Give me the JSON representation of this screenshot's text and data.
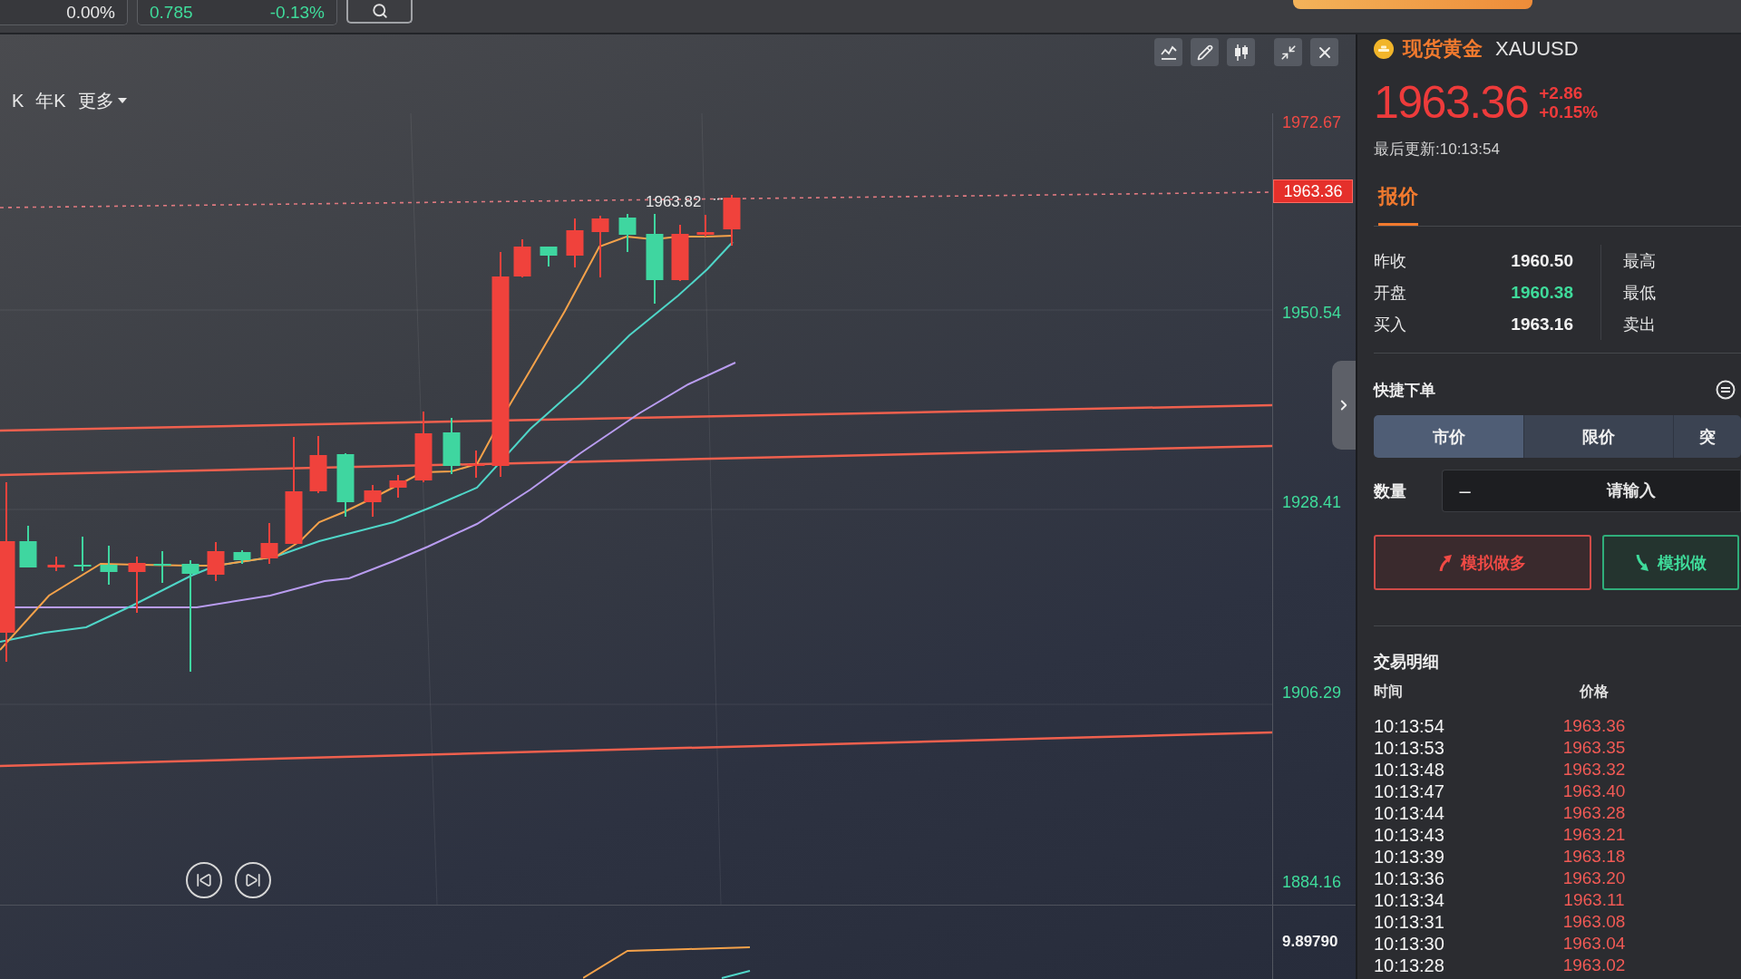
{
  "top_bar": {
    "quote_cards": [
      {
        "values": [
          {
            "text": "0.00%",
            "color": "#e8e8e8"
          }
        ]
      },
      {
        "values": [
          {
            "text": "0.785",
            "color": "#3fdc9b"
          },
          {
            "text": "-0.13%",
            "color": "#3fdc9b"
          }
        ]
      }
    ]
  },
  "chart": {
    "periods": [
      {
        "label": "K",
        "selected": false
      },
      {
        "label": "年K",
        "selected": false
      }
    ],
    "more_menu": {
      "label": "更多"
    },
    "y_axis": [
      {
        "label": "1972.67",
        "color": "#f04a45"
      },
      {
        "label": "1950.54",
        "color": "#3fdc9b"
      },
      {
        "label": "1928.41",
        "color": "#3fdc9b"
      },
      {
        "label": "1906.29",
        "color": "#3fdc9b"
      },
      {
        "label": "1884.16",
        "color": "#3fdc9b"
      }
    ],
    "price_tag": "1963.36",
    "high_marker": "1963.82",
    "indicator_axis": "9.89790"
  },
  "instrument": {
    "name": "现货黄金",
    "symbol": "XAUUSD",
    "price": "1963.36",
    "change": "+2.86",
    "change_percent": "+0.15%",
    "color": "#ee3b3b",
    "updated": "最后更新:10:13:54"
  },
  "quote_tabs": [
    {
      "label": "报价",
      "selected": true
    }
  ],
  "quote_rows": [
    {
      "label": "昨收",
      "value": "1960.50",
      "color": "#f2f2f2",
      "side_label": "最高"
    },
    {
      "label": "开盘",
      "value": "1960.38",
      "color": "#3fdc9b",
      "side_label": "最低"
    },
    {
      "label": "买入",
      "value": "1963.16",
      "color": "#f2f2f2",
      "side_label": "卖出"
    }
  ],
  "quick_order": {
    "title": "快捷下单",
    "order_types": [
      {
        "label": "市价",
        "selected": true
      },
      {
        "label": "限价",
        "selected": false
      },
      {
        "label": "突",
        "selected": false
      }
    ],
    "quantity": {
      "label": "数量",
      "decrement": "–",
      "placeholder": "请输入"
    },
    "actions": [
      {
        "label": "模拟做多",
        "kind": "long"
      },
      {
        "label": "模拟做",
        "kind": "short"
      }
    ]
  },
  "trades": {
    "title": "交易明细",
    "columns": [
      "时间",
      "价格"
    ],
    "rows": [
      {
        "time": "10:13:54",
        "price": "1963.36",
        "color": "#f25a55"
      },
      {
        "time": "10:13:53",
        "price": "1963.35",
        "color": "#f25a55"
      },
      {
        "time": "10:13:48",
        "price": "1963.32",
        "color": "#f25a55"
      },
      {
        "time": "10:13:47",
        "price": "1963.40",
        "color": "#f25a55"
      },
      {
        "time": "10:13:44",
        "price": "1963.28",
        "color": "#f25a55"
      },
      {
        "time": "10:13:43",
        "price": "1963.21",
        "color": "#f25a55"
      },
      {
        "time": "10:13:39",
        "price": "1963.18",
        "color": "#f25a55"
      },
      {
        "time": "10:13:36",
        "price": "1963.20",
        "color": "#f25a55"
      },
      {
        "time": "10:13:34",
        "price": "1963.11",
        "color": "#f25a55"
      },
      {
        "time": "10:13:31",
        "price": "1963.08",
        "color": "#f25a55"
      },
      {
        "time": "10:13:30",
        "price": "1963.04",
        "color": "#f25a55"
      },
      {
        "time": "10:13:28",
        "price": "1963.02",
        "color": "#f25a55"
      }
    ]
  }
}
